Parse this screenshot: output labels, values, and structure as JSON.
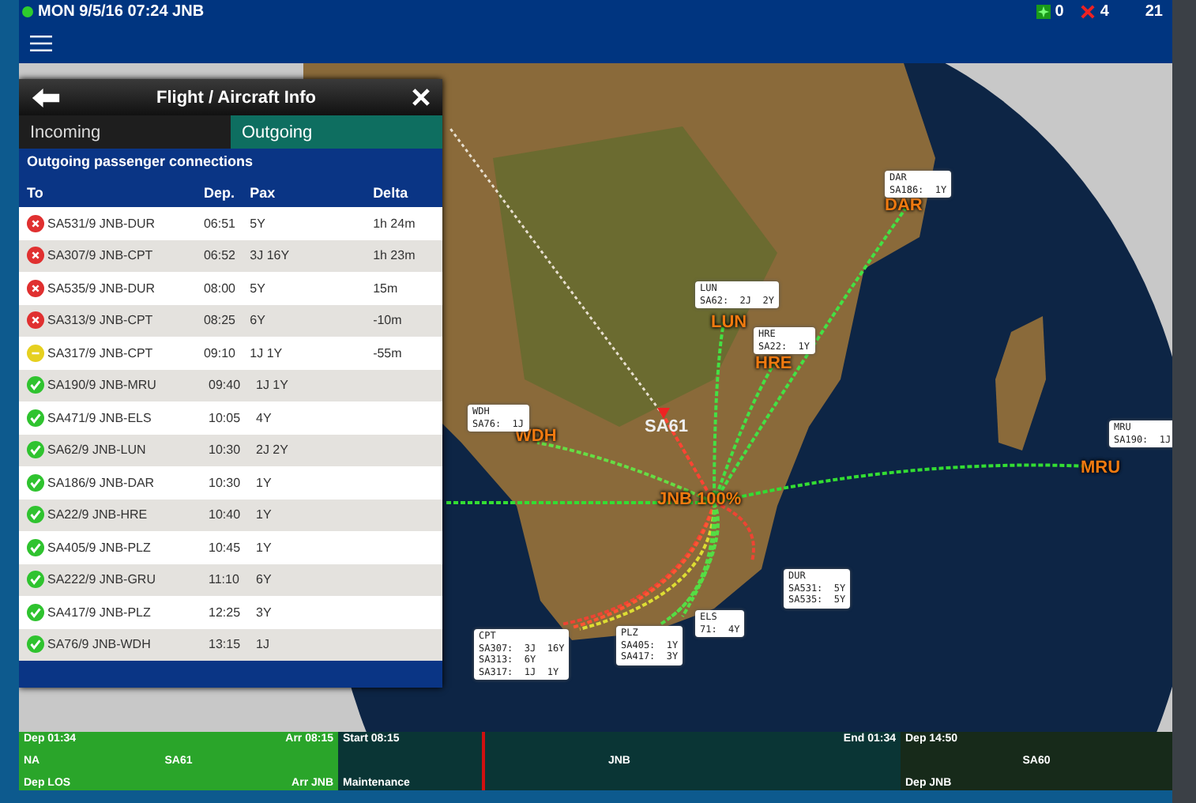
{
  "status_bar": {
    "online": true,
    "datetime": "MON 9/5/16 07:24 JNB",
    "alerts": [
      {
        "kind": "ok",
        "count": "0"
      },
      {
        "kind": "error",
        "count": "4"
      }
    ],
    "count": "21"
  },
  "panel": {
    "title": "Flight / Aircraft Info",
    "tabs": [
      {
        "label": "Incoming",
        "selected": false
      },
      {
        "label": "Outgoing",
        "selected": true
      }
    ],
    "section_title": "Outgoing passenger connections",
    "columns": [
      "To",
      "Dep.",
      "Pax",
      "Delta"
    ],
    "rows": [
      {
        "kind": "error",
        "flight": "SA531/9 JNB-DUR",
        "dep": "06:51",
        "pax": "5Y",
        "delta": "1h 24m"
      },
      {
        "kind": "error",
        "flight": "SA307/9 JNB-CPT",
        "dep": "06:52",
        "pax": "3J 16Y",
        "delta": "1h 23m"
      },
      {
        "kind": "error",
        "flight": "SA535/9 JNB-DUR",
        "dep": "08:00",
        "pax": "5Y",
        "delta": "15m"
      },
      {
        "kind": "error",
        "flight": "SA313/9 JNB-CPT",
        "dep": "08:25",
        "pax": "6Y",
        "delta": "-10m"
      },
      {
        "kind": "warning",
        "flight": "SA317/9 JNB-CPT",
        "dep": "09:10",
        "pax": "1J 1Y",
        "delta": "-55m"
      },
      {
        "kind": "ok",
        "flight": "SA190/9 JNB-MRU",
        "dep": "09:40",
        "pax": "1J 1Y"
      },
      {
        "kind": "ok",
        "flight": "SA471/9 JNB-ELS",
        "dep": "10:05",
        "pax": "4Y"
      },
      {
        "kind": "ok",
        "flight": "SA62/9 JNB-LUN",
        "dep": "10:30",
        "pax": "2J 2Y"
      },
      {
        "kind": "ok",
        "flight": "SA186/9 JNB-DAR",
        "dep": "10:30",
        "pax": "1Y"
      },
      {
        "kind": "ok",
        "flight": "SA22/9 JNB-HRE",
        "dep": "10:40",
        "pax": "1Y"
      },
      {
        "kind": "ok",
        "flight": "SA405/9 JNB-PLZ",
        "dep": "10:45",
        "pax": "1Y"
      },
      {
        "kind": "ok",
        "flight": "SA222/9 JNB-GRU",
        "dep": "11:10",
        "pax": "6Y"
      },
      {
        "kind": "ok",
        "flight": "SA417/9 JNB-PLZ",
        "dep": "12:25",
        "pax": "3Y"
      },
      {
        "kind": "ok",
        "flight": "SA76/9 JNB-WDH",
        "dep": "13:15",
        "pax": "1J"
      }
    ]
  },
  "map": {
    "airport_labels": [
      "DAR",
      "LUN",
      "HRE",
      "WDH",
      "MRU",
      "JNB 100%"
    ],
    "aircraft_label": "SA61",
    "callouts": [
      {
        "lines": [
          "DAR",
          "SA186:  1Y"
        ]
      },
      {
        "lines": [
          "LUN",
          "SA62:  2J  2Y"
        ]
      },
      {
        "lines": [
          "HRE",
          "SA22:  1Y"
        ]
      },
      {
        "lines": [
          "WDH",
          "SA76:  1J"
        ]
      },
      {
        "lines": [
          "MRU",
          "SA190:  1J"
        ]
      },
      {
        "lines": [
          "DUR",
          "SA531:  5Y",
          "SA535:  5Y"
        ]
      },
      {
        "lines": [
          "CPT",
          "SA307:  3J  16Y",
          "SA313:  6Y",
          "SA317:  1J  1Y"
        ]
      },
      {
        "lines": [
          "PLZ",
          "SA405:  1Y",
          "SA417:  3Y"
        ]
      },
      {
        "lines": [
          "ELS",
          "71:  4Y"
        ]
      }
    ]
  },
  "timeline": [
    {
      "kind": "flight",
      "top_left": "Dep 01:34",
      "top_right": "Arr 08:15",
      "mid_left": "NA",
      "center": "SA61",
      "bottom_left": "Dep LOS",
      "bottom_right": "Arr JNB"
    },
    {
      "kind": "ground",
      "top_left": "Start 08:15",
      "top_right": "End 01:34",
      "center": "JNB",
      "bottom_left": "Maintenance"
    },
    {
      "kind": "next",
      "top_left": "Dep 14:50",
      "center": "SA60",
      "bottom_left": "Dep JNB"
    }
  ]
}
